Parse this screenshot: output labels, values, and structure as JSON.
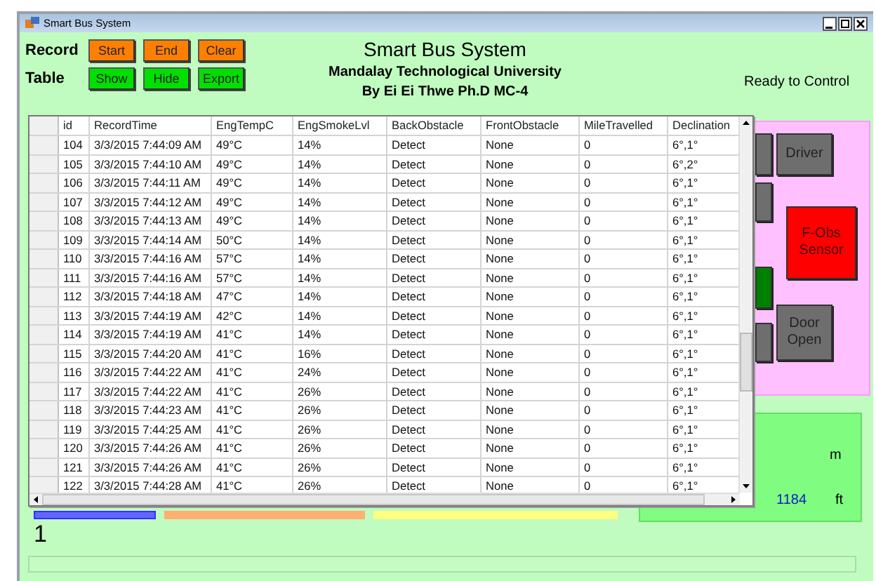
{
  "window": {
    "title": "Smart Bus System"
  },
  "record": {
    "label": "Record",
    "buttons": [
      "Start",
      "End",
      "Clear"
    ]
  },
  "table": {
    "label": "Table",
    "buttons": [
      "Show",
      "Hide",
      "Export"
    ]
  },
  "heading": {
    "title": "Smart Bus System",
    "university": "Mandalay Technological University",
    "author": "By Ei Ei Thwe Ph.D MC-4"
  },
  "status": "Ready to Control",
  "side_panel": {
    "buttons": [
      {
        "color": "#6e6e6e"
      },
      {
        "label": "Driver",
        "color": "#6e6e6e"
      },
      {
        "color": "#6e6e6e"
      },
      {
        "label": "F-Obs Sensor",
        "color": "#ff0000"
      },
      {
        "color": "#008000"
      },
      {
        "color": "#6e6e6e"
      },
      {
        "label": "Door Open",
        "color": "#6e6e6e"
      }
    ]
  },
  "distance": {
    "meter_unit": "m",
    "feet_value": "1184",
    "feet_unit": "ft"
  },
  "bars": [
    {
      "color": "#6464ff"
    },
    {
      "color": "#ffb070"
    },
    {
      "color": "#ffff80"
    }
  ],
  "counter": "1",
  "grid": {
    "columns": [
      "id",
      "RecordTime",
      "EngTempC",
      "EngSmokeLvl",
      "BackObstacle",
      "FrontObstacle",
      "MileTravelled",
      "Declination"
    ],
    "rows": [
      [
        "104",
        "3/3/2015 7:44:09 AM",
        "49°C",
        "14%",
        "Detect",
        "None",
        "0",
        "6°,1°"
      ],
      [
        "105",
        "3/3/2015 7:44:10 AM",
        "49°C",
        "14%",
        "Detect",
        "None",
        "0",
        "6°,2°"
      ],
      [
        "106",
        "3/3/2015 7:44:11 AM",
        "49°C",
        "14%",
        "Detect",
        "None",
        "0",
        "6°,1°"
      ],
      [
        "107",
        "3/3/2015 7:44:12 AM",
        "49°C",
        "14%",
        "Detect",
        "None",
        "0",
        "6°,1°"
      ],
      [
        "108",
        "3/3/2015 7:44:13 AM",
        "49°C",
        "14%",
        "Detect",
        "None",
        "0",
        "6°,1°"
      ],
      [
        "109",
        "3/3/2015 7:44:14 AM",
        "50°C",
        "14%",
        "Detect",
        "None",
        "0",
        "6°,1°"
      ],
      [
        "110",
        "3/3/2015 7:44:16 AM",
        "57°C",
        "14%",
        "Detect",
        "None",
        "0",
        "6°,1°"
      ],
      [
        "111",
        "3/3/2015 7:44:16 AM",
        "57°C",
        "14%",
        "Detect",
        "None",
        "0",
        "6°,1°"
      ],
      [
        "112",
        "3/3/2015 7:44:18 AM",
        "47°C",
        "14%",
        "Detect",
        "None",
        "0",
        "6°,1°"
      ],
      [
        "113",
        "3/3/2015 7:44:19 AM",
        "42°C",
        "14%",
        "Detect",
        "None",
        "0",
        "6°,1°"
      ],
      [
        "114",
        "3/3/2015 7:44:19 AM",
        "41°C",
        "14%",
        "Detect",
        "None",
        "0",
        "6°,1°"
      ],
      [
        "115",
        "3/3/2015 7:44:20 AM",
        "41°C",
        "16%",
        "Detect",
        "None",
        "0",
        "6°,1°"
      ],
      [
        "116",
        "3/3/2015 7:44:22 AM",
        "41°C",
        "24%",
        "Detect",
        "None",
        "0",
        "6°,1°"
      ],
      [
        "117",
        "3/3/2015 7:44:22 AM",
        "41°C",
        "26%",
        "Detect",
        "None",
        "0",
        "6°,1°"
      ],
      [
        "118",
        "3/3/2015 7:44:23 AM",
        "41°C",
        "26%",
        "Detect",
        "None",
        "0",
        "6°,1°"
      ],
      [
        "119",
        "3/3/2015 7:44:25 AM",
        "41°C",
        "26%",
        "Detect",
        "None",
        "0",
        "6°,1°"
      ],
      [
        "120",
        "3/3/2015 7:44:26 AM",
        "41°C",
        "26%",
        "Detect",
        "None",
        "0",
        "6°,1°"
      ],
      [
        "121",
        "3/3/2015 7:44:26 AM",
        "41°C",
        "26%",
        "Detect",
        "None",
        "0",
        "6°,1°"
      ],
      [
        "122",
        "3/3/2015 7:44:28 AM",
        "41°C",
        "26%",
        "Detect",
        "None",
        "0",
        "6°,1°"
      ]
    ]
  }
}
